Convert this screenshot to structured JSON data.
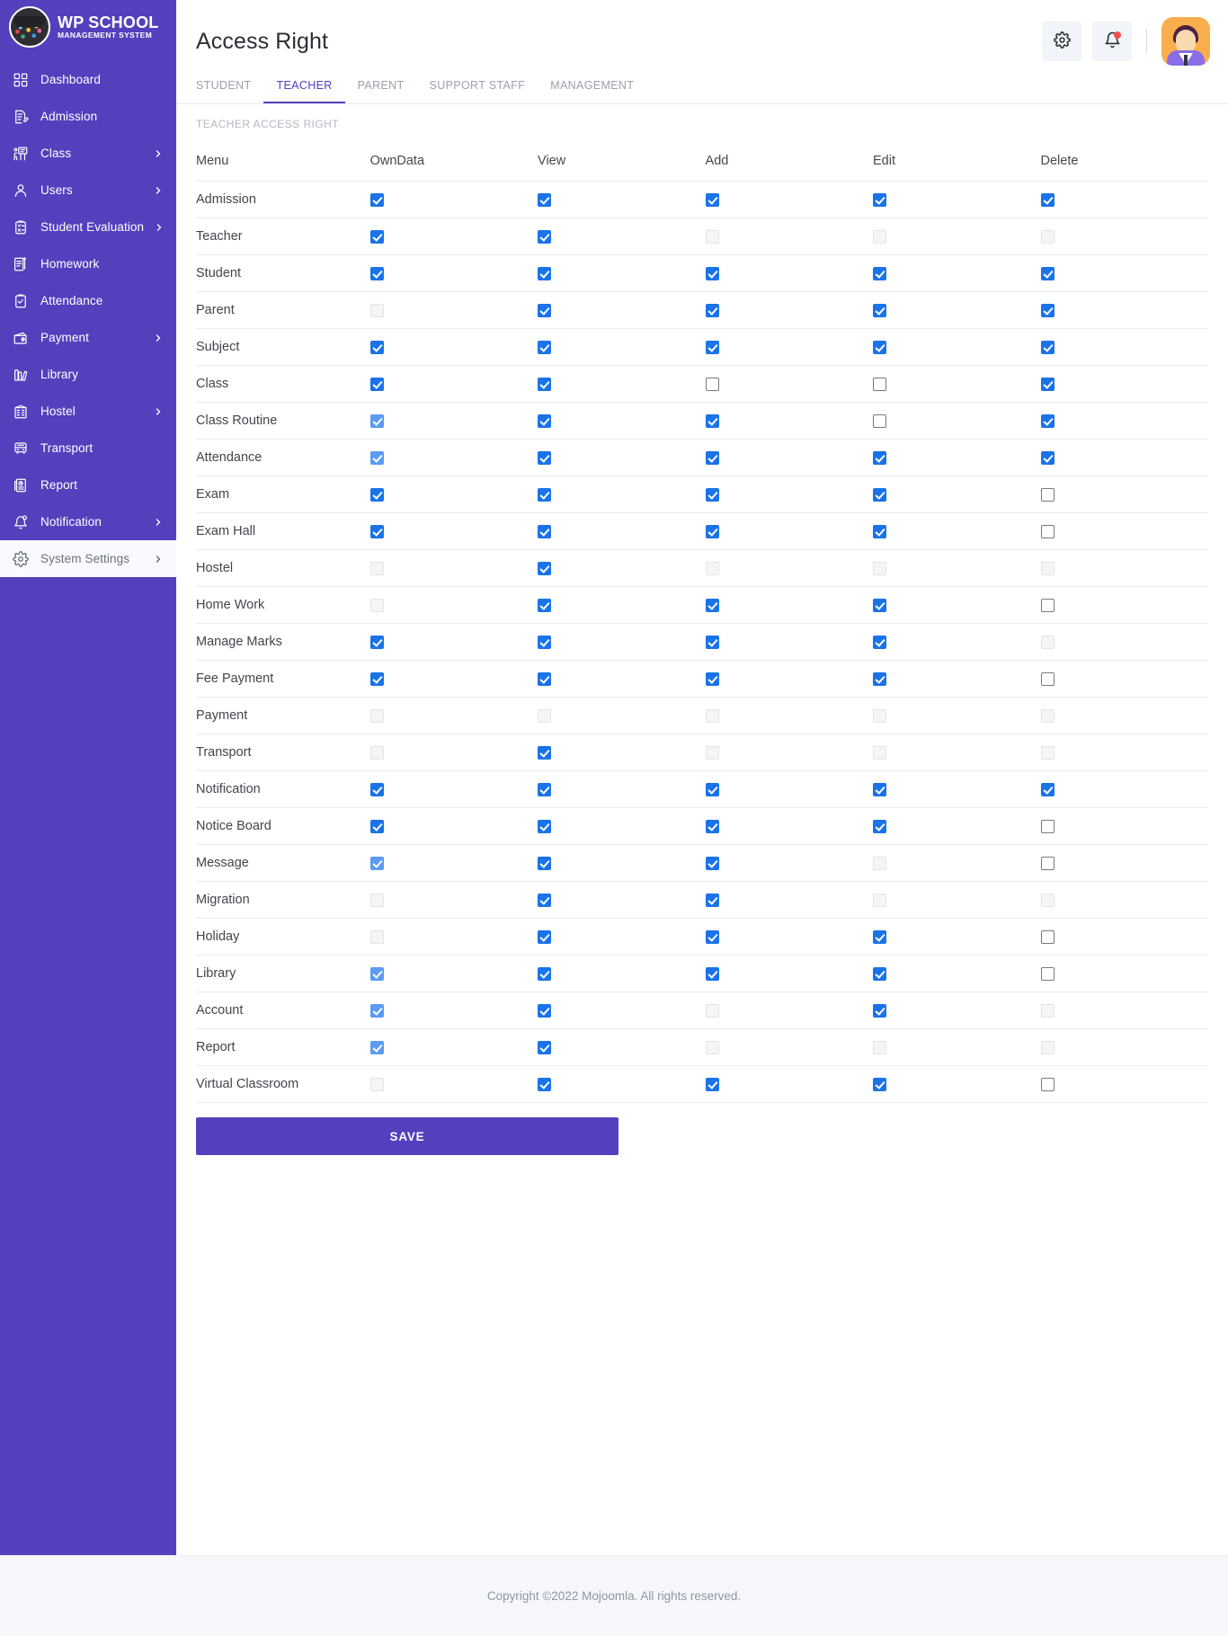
{
  "brand": {
    "title": "WP SCHOOL",
    "subtitle": "MANAGEMENT SYSTEM",
    "logo_icon": "graduation-cap-logo"
  },
  "sidebar": {
    "items": [
      {
        "label": "Dashboard",
        "icon": "grid-icon",
        "caret": false,
        "active": false
      },
      {
        "label": "Admission",
        "icon": "document-pen-icon",
        "caret": false,
        "active": false
      },
      {
        "label": "Class",
        "icon": "classroom-icon",
        "caret": true,
        "active": false
      },
      {
        "label": "Users",
        "icon": "user-icon",
        "caret": true,
        "active": false
      },
      {
        "label": "Student Evaluation",
        "icon": "clipboard-icon",
        "caret": true,
        "active": false
      },
      {
        "label": "Homework",
        "icon": "notebook-icon",
        "caret": false,
        "active": false
      },
      {
        "label": "Attendance",
        "icon": "clipboard-check-icon",
        "caret": false,
        "active": false
      },
      {
        "label": "Payment",
        "icon": "wallet-icon",
        "caret": true,
        "active": false
      },
      {
        "label": "Library",
        "icon": "books-icon",
        "caret": false,
        "active": false
      },
      {
        "label": "Hostel",
        "icon": "building-icon",
        "caret": true,
        "active": false
      },
      {
        "label": "Transport",
        "icon": "bus-icon",
        "caret": false,
        "active": false
      },
      {
        "label": "Report",
        "icon": "report-icon",
        "caret": false,
        "active": false
      },
      {
        "label": "Notification",
        "icon": "bell-icon",
        "caret": true,
        "active": false
      },
      {
        "label": "System Settings",
        "icon": "gear-icon",
        "caret": true,
        "active": true
      }
    ]
  },
  "header": {
    "title": "Access Right",
    "settings_icon": "gear-icon",
    "notification_icon": "bell-icon",
    "avatar_icon": "user-avatar"
  },
  "tabs": [
    {
      "label": "STUDENT",
      "active": false
    },
    {
      "label": "TEACHER",
      "active": true
    },
    {
      "label": "PARENT",
      "active": false
    },
    {
      "label": "SUPPORT STAFF",
      "active": false
    },
    {
      "label": "MANAGEMENT",
      "active": false
    }
  ],
  "section_label": "TEACHER ACCESS RIGHT",
  "table": {
    "columns": [
      "Menu",
      "OwnData",
      "View",
      "Add",
      "Edit",
      "Delete"
    ],
    "rows": [
      {
        "menu": "Admission",
        "states": [
          "on",
          "on",
          "on",
          "on",
          "on"
        ]
      },
      {
        "menu": "Teacher",
        "states": [
          "on",
          "on",
          "off-dim",
          "off-dim",
          "off-dim"
        ]
      },
      {
        "menu": "Student",
        "states": [
          "on",
          "on",
          "on",
          "on",
          "on"
        ]
      },
      {
        "menu": "Parent",
        "states": [
          "off-dim",
          "on",
          "on",
          "on",
          "on"
        ]
      },
      {
        "menu": "Subject",
        "states": [
          "on",
          "on",
          "on",
          "on",
          "on"
        ]
      },
      {
        "menu": "Class",
        "states": [
          "on",
          "on",
          "off",
          "off",
          "on"
        ]
      },
      {
        "menu": "Class Routine",
        "states": [
          "on-dim",
          "on",
          "on",
          "off",
          "on"
        ]
      },
      {
        "menu": "Attendance",
        "states": [
          "on-dim",
          "on",
          "on",
          "on",
          "on"
        ]
      },
      {
        "menu": "Exam",
        "states": [
          "on",
          "on",
          "on",
          "on",
          "off"
        ]
      },
      {
        "menu": "Exam Hall",
        "states": [
          "on",
          "on",
          "on",
          "on",
          "off"
        ]
      },
      {
        "menu": "Hostel",
        "states": [
          "off-dim",
          "on",
          "off-dim",
          "off-dim",
          "off-dim"
        ]
      },
      {
        "menu": "Home Work",
        "states": [
          "off-dim",
          "on",
          "on",
          "on",
          "off"
        ]
      },
      {
        "menu": "Manage Marks",
        "states": [
          "on",
          "on",
          "on",
          "on",
          "off-dim"
        ]
      },
      {
        "menu": "Fee Payment",
        "states": [
          "on",
          "on",
          "on",
          "on",
          "off"
        ]
      },
      {
        "menu": "Payment",
        "states": [
          "off-dim",
          "off-dim",
          "off-dim",
          "off-dim",
          "off-dim"
        ]
      },
      {
        "menu": "Transport",
        "states": [
          "off-dim",
          "on",
          "off-dim",
          "off-dim",
          "off-dim"
        ]
      },
      {
        "menu": "Notification",
        "states": [
          "on",
          "on",
          "on",
          "on",
          "on"
        ]
      },
      {
        "menu": "Notice Board",
        "states": [
          "on",
          "on",
          "on",
          "on",
          "off"
        ]
      },
      {
        "menu": "Message",
        "states": [
          "on-dim",
          "on",
          "on",
          "off-dim",
          "off"
        ]
      },
      {
        "menu": "Migration",
        "states": [
          "off-dim",
          "on",
          "on",
          "off-dim",
          "off-dim"
        ]
      },
      {
        "menu": "Holiday",
        "states": [
          "off-dim",
          "on",
          "on",
          "on",
          "off"
        ]
      },
      {
        "menu": "Library",
        "states": [
          "on-dim",
          "on",
          "on",
          "on",
          "off"
        ]
      },
      {
        "menu": "Account",
        "states": [
          "on-dim",
          "on",
          "off-dim",
          "on",
          "off-dim"
        ]
      },
      {
        "menu": "Report",
        "states": [
          "on-dim",
          "on",
          "off-dim",
          "off-dim",
          "off-dim"
        ]
      },
      {
        "menu": "Virtual Classroom",
        "states": [
          "off-dim",
          "on",
          "on",
          "on",
          "off"
        ]
      }
    ]
  },
  "save_label": "SAVE",
  "footer": {
    "text": "Copyright ©2022 Mojoomla. All rights reserved."
  },
  "colors": {
    "brand_purple": "#5440bd",
    "checkbox_blue": "#1a73e8",
    "checkbox_blue_dim": "#5b9bf1",
    "notification_dot": "#f5504f",
    "avatar_bg": "#f9ae4d"
  }
}
